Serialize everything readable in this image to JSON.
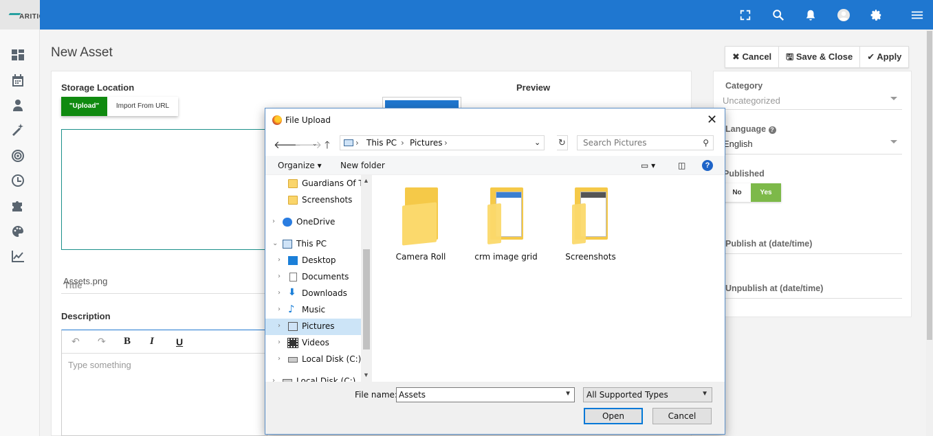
{
  "app": {
    "logo_text": "ARITIC"
  },
  "topbar": {
    "icons": [
      "fullscreen-icon",
      "search-icon",
      "bell-icon",
      "user-avatar-icon",
      "gear-icon",
      "menu-icon"
    ]
  },
  "leftnav": {
    "icons": [
      "dashboard-icon",
      "calendar-icon",
      "contacts-icon",
      "magic-wand-icon",
      "target-icon",
      "clock-icon",
      "puzzle-icon",
      "palette-icon",
      "chart-line-icon"
    ]
  },
  "page": {
    "title": "New Asset"
  },
  "toolbar": {
    "cancel": "Cancel",
    "save_close": "Save & Close",
    "apply": "Apply"
  },
  "form": {
    "storage_location_label": "Storage Location",
    "tab_upload": "\"Upload\"",
    "tab_url": "Import From URL",
    "preview_label": "Preview",
    "title_placeholder": "Title",
    "title_value": "Assets.png",
    "description_label": "Description",
    "editor_placeholder": "Type something",
    "editor_tools": {
      "undo": "↶",
      "redo": "↷",
      "bold": "B",
      "italic": "I",
      "underline": "U"
    }
  },
  "sidebar_form": {
    "category_label": "Category",
    "category_value": "Uncategorized",
    "language_label": "Language",
    "language_value": "English",
    "published_label": "Published",
    "toggle_no": "No",
    "toggle_yes": "Yes",
    "publish_at_label": "Publish at (date/time)",
    "unpublish_at_label": "Unpublish at (date/time)"
  },
  "dialog": {
    "title": "File Upload",
    "breadcrumb": [
      "This PC",
      "Pictures"
    ],
    "search_placeholder": "Search Pictures",
    "organize": "Organize",
    "new_folder": "New folder",
    "tree": [
      {
        "label": "Guardians Of Th",
        "icon": "folder-icon"
      },
      {
        "label": "Screenshots",
        "icon": "folder-icon"
      },
      {
        "label": "OneDrive",
        "icon": "onedrive-icon"
      },
      {
        "label": "This PC",
        "icon": "computer-icon"
      },
      {
        "label": "Desktop",
        "icon": "desktop-icon"
      },
      {
        "label": "Documents",
        "icon": "documents-icon"
      },
      {
        "label": "Downloads",
        "icon": "downloads-icon"
      },
      {
        "label": "Music",
        "icon": "music-icon"
      },
      {
        "label": "Pictures",
        "icon": "pictures-icon",
        "selected": true
      },
      {
        "label": "Videos",
        "icon": "videos-icon"
      },
      {
        "label": "Local Disk (C:)",
        "icon": "disk-icon"
      },
      {
        "label": "Local Disk (C:)",
        "icon": "disk-icon"
      }
    ],
    "files": [
      {
        "name": "Camera Roll"
      },
      {
        "name": "crm image grid"
      },
      {
        "name": "Screenshots"
      }
    ],
    "file_name_label": "File name:",
    "file_name_value": "Assets",
    "file_type": "All Supported Types",
    "open": "Open",
    "cancel": "Cancel"
  }
}
